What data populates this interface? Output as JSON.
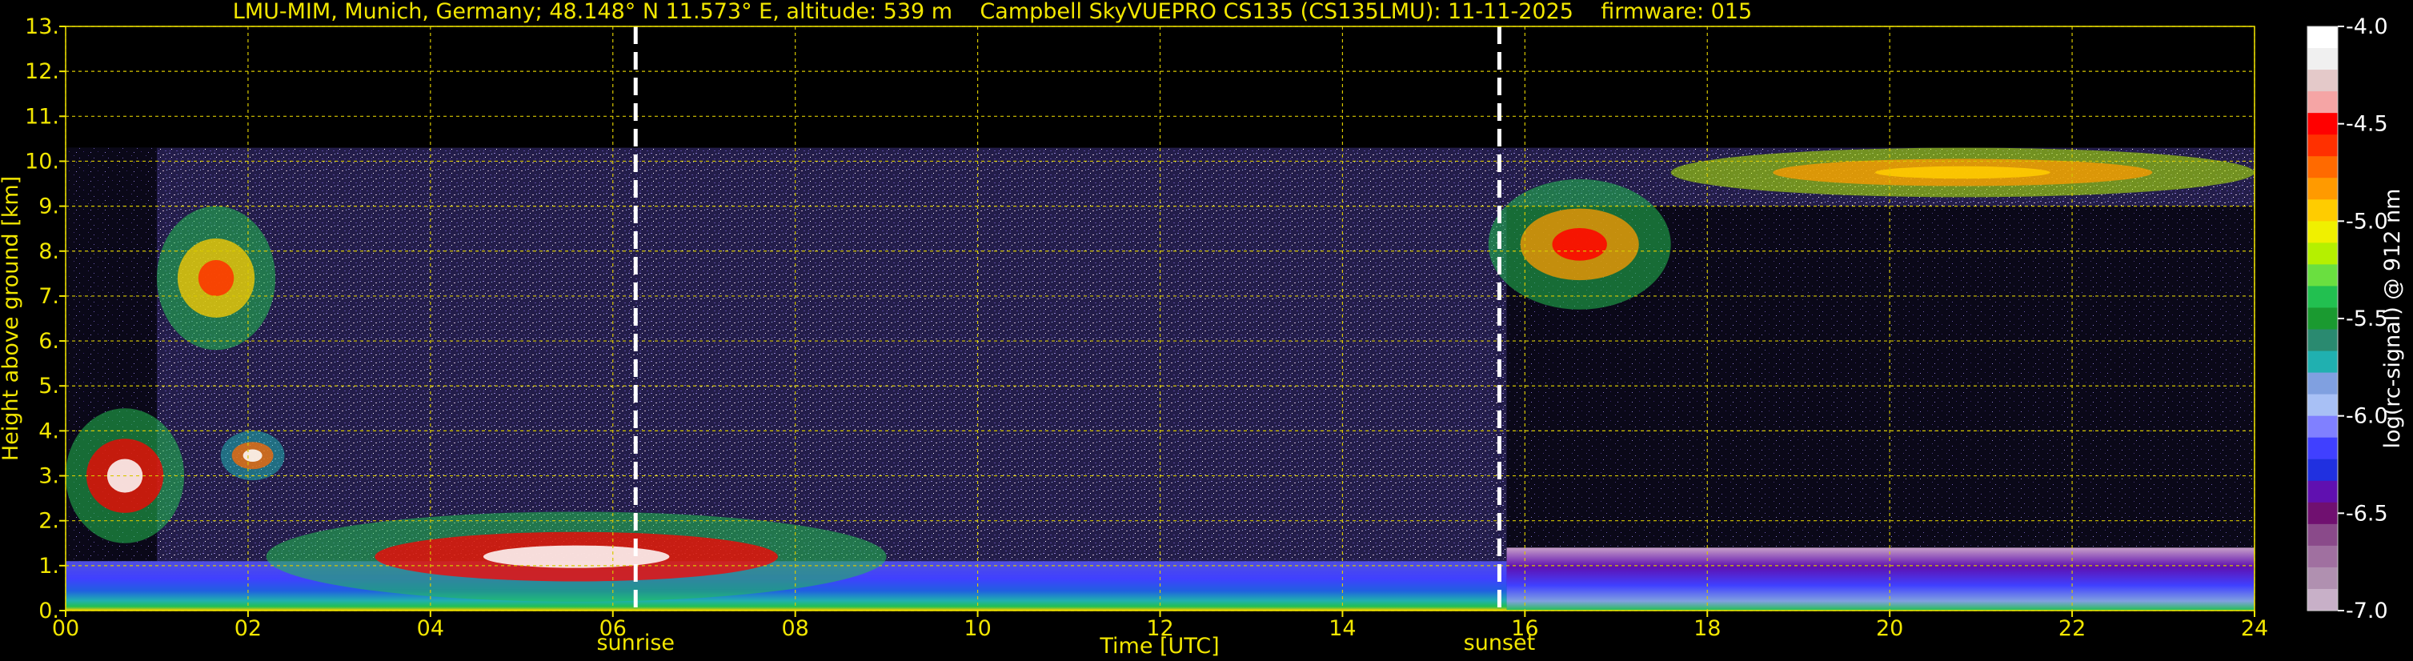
{
  "title": {
    "site": "LMU-MIM, Munich, Germany; 48.148° N 11.573° E, altitude: 539 m",
    "instrument": "Campbell SkyVUEPRO CS135 (CS135LMU): 11-11-2025",
    "firmware": "firmware: 015"
  },
  "chart_data": {
    "type": "heatmap",
    "xlabel": "Time [UTC]",
    "ylabel": "Height above ground [km]",
    "xlim": [
      0,
      24
    ],
    "ylim": [
      0,
      13
    ],
    "x_ticks": [
      "00",
      "02",
      "04",
      "06",
      "08",
      "10",
      "12",
      "14",
      "16",
      "18",
      "20",
      "22",
      "24"
    ],
    "y_ticks": [
      "0.",
      "1.",
      "2.",
      "3.",
      "4.",
      "5.",
      "6.",
      "7.",
      "8.",
      "9.",
      "10.",
      "11.",
      "12.",
      "13."
    ],
    "grid": true,
    "markers": [
      {
        "label": "sunrise",
        "x": 6.25
      },
      {
        "label": "sunset",
        "x": 15.72
      }
    ],
    "colorbar": {
      "label": "log(rc-signal) @ 912 nm",
      "range": [
        -7.0,
        -4.0
      ],
      "ticks": [
        "-4.0",
        "-4.5",
        "-5.0",
        "-5.5",
        "-6.0",
        "-6.5",
        "-7.0"
      ],
      "colors": [
        "#ffffff",
        "#f0f0f0",
        "#e4c9c9",
        "#f5a5a5",
        "#ff0000",
        "#ff3000",
        "#ff6a00",
        "#ff9a00",
        "#ffcc00",
        "#f0f000",
        "#b5f000",
        "#6adf40",
        "#22c050",
        "#1a9a30",
        "#2a8a70",
        "#20b0b0",
        "#80a0e0",
        "#a8c0f5",
        "#8080ff",
        "#4040ff",
        "#2030e0",
        "#6010b0",
        "#701070",
        "#8a4a8a",
        "#a070a0",
        "#b090b0",
        "#c8b0c8"
      ]
    },
    "features": [
      {
        "name": "aerosol boundary layer",
        "x": [
          0,
          24
        ],
        "y": [
          0,
          1.1
        ]
      },
      {
        "name": "noise region",
        "x": [
          0,
          24
        ],
        "y": [
          1.1,
          10.3
        ]
      },
      {
        "name": "low cloud segment",
        "x": [
          0.0,
          1.3
        ],
        "y": [
          1.5,
          4.5
        ]
      },
      {
        "name": "cirrus cloud early",
        "x": [
          1.0,
          2.3
        ],
        "y": [
          5.8,
          9.0
        ]
      },
      {
        "name": "mid cloud patch",
        "x": [
          1.7,
          2.4
        ],
        "y": [
          2.9,
          4.0
        ]
      },
      {
        "name": "low cloud layer morning",
        "x": [
          2.2,
          9.0
        ],
        "y": [
          0.2,
          2.2
        ]
      },
      {
        "name": "cirrus cloud evening",
        "x": [
          15.6,
          17.6
        ],
        "y": [
          6.7,
          9.6
        ]
      },
      {
        "name": "high cirrus top",
        "x": [
          17.6,
          24.0
        ],
        "y": [
          9.2,
          10.3
        ]
      }
    ]
  }
}
